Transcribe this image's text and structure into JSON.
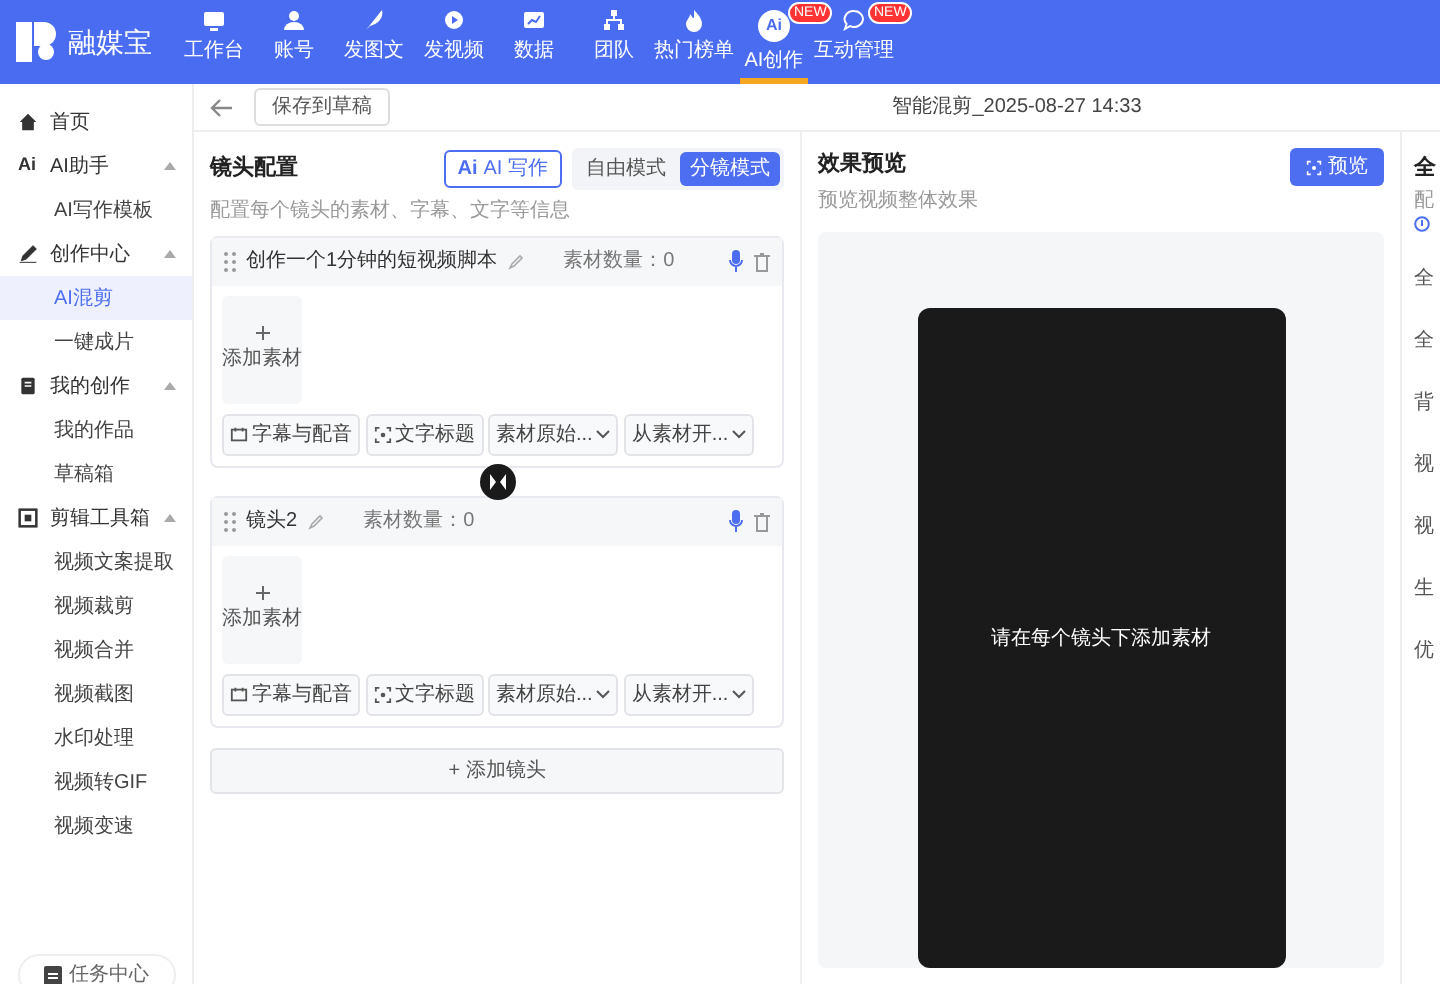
{
  "app": {
    "logo_text": "融媒宝"
  },
  "nav": [
    {
      "label": "工作台",
      "selected": false
    },
    {
      "label": "账号",
      "selected": false
    },
    {
      "label": "发图文",
      "selected": false
    },
    {
      "label": "发视频",
      "selected": false
    },
    {
      "label": "数据",
      "selected": false
    },
    {
      "label": "团队",
      "selected": false
    },
    {
      "label": "热门榜单",
      "selected": false
    },
    {
      "label": "AI创作",
      "selected": true,
      "badge": "NEW",
      "icon_text": "Ai"
    },
    {
      "label": "互动管理",
      "selected": false,
      "badge": "NEW"
    }
  ],
  "sidebar": {
    "items": [
      {
        "label": "首页",
        "kind": "link",
        "selected": false
      },
      {
        "label": "AI助手",
        "kind": "group",
        "icon_text": "Ai",
        "expanded": true,
        "children": [
          {
            "label": "AI写作模板",
            "selected": false
          }
        ]
      },
      {
        "label": "创作中心",
        "kind": "group",
        "expanded": true,
        "children": [
          {
            "label": "AI混剪",
            "selected": true
          },
          {
            "label": "一键成片",
            "selected": false
          }
        ]
      },
      {
        "label": "我的创作",
        "kind": "group",
        "expanded": true,
        "children": [
          {
            "label": "我的作品",
            "selected": false
          },
          {
            "label": "草稿箱",
            "selected": false
          }
        ]
      },
      {
        "label": "剪辑工具箱",
        "kind": "group",
        "expanded": true,
        "children": [
          {
            "label": "视频文案提取",
            "selected": false
          },
          {
            "label": "视频裁剪",
            "selected": false
          },
          {
            "label": "视频合并",
            "selected": false
          },
          {
            "label": "视频截图",
            "selected": false
          },
          {
            "label": "水印处理",
            "selected": false
          },
          {
            "label": "视频转GIF",
            "selected": false
          },
          {
            "label": "视频变速",
            "selected": false
          }
        ]
      }
    ],
    "footer_button": "任务中心"
  },
  "header": {
    "save_button": "保存到草稿",
    "title": "智能混剪_2025-08-27 14:33"
  },
  "shots_panel": {
    "title": "镜头配置",
    "subtitle": "配置每个镜头的素材、字幕、文字等信息",
    "ai_button": {
      "icon_text": "Ai",
      "label": "AI 写作"
    },
    "modes": [
      {
        "label": "自由模式",
        "selected": false
      },
      {
        "label": "分镜模式",
        "selected": true
      }
    ],
    "shots": [
      {
        "title": "创作一个1分钟的短视频脚本",
        "count": "素材数量：0",
        "add_label": "添加素材",
        "tools": [
          {
            "label": "字幕与配音",
            "kind": "button"
          },
          {
            "label": "文字标题",
            "kind": "button"
          },
          {
            "label": "素材原始...",
            "kind": "dropdown"
          },
          {
            "label": "从素材开...",
            "kind": "dropdown"
          }
        ]
      },
      {
        "title": "镜头2",
        "count": "素材数量：0",
        "add_label": "添加素材",
        "tools": [
          {
            "label": "字幕与配音",
            "kind": "button"
          },
          {
            "label": "文字标题",
            "kind": "button"
          },
          {
            "label": "素材原始...",
            "kind": "dropdown"
          },
          {
            "label": "从素材开...",
            "kind": "dropdown"
          }
        ]
      }
    ],
    "add_shot_button": "+ 添加镜头"
  },
  "preview": {
    "title": "效果预览",
    "subtitle": "预览视频整体效果",
    "preview_button": "预览",
    "empty_message": "请在每个镜头下添加素材"
  },
  "settings_panel": {
    "title": "全",
    "subtitle": "配",
    "labels": [
      "全",
      "全",
      "背",
      "视",
      "视",
      "生",
      "优"
    ]
  }
}
